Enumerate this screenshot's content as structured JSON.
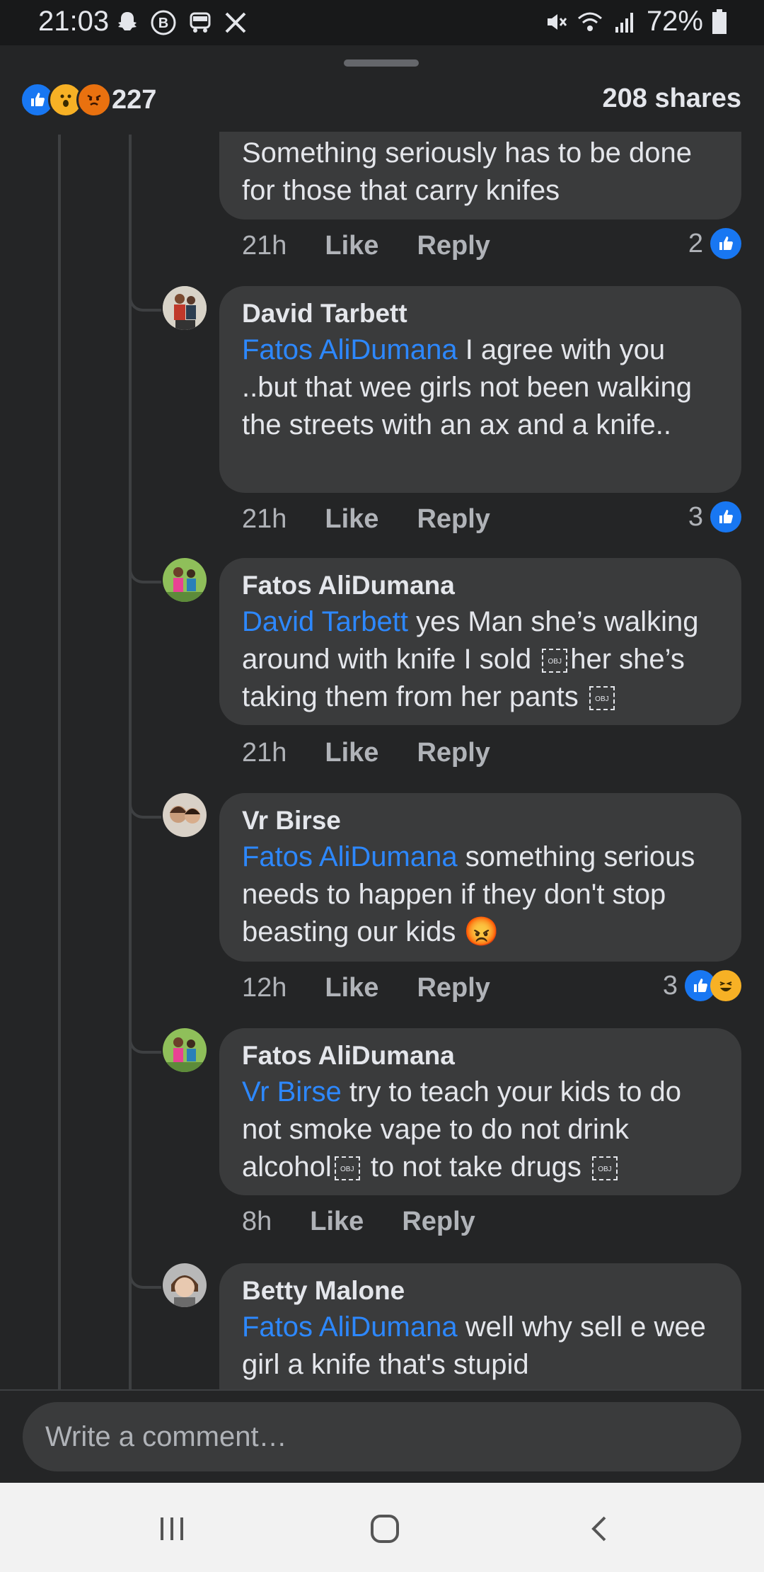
{
  "status_bar": {
    "time": "21:03",
    "battery": "72%",
    "left_icons": [
      "snapchat-icon",
      "bitcoin-icon",
      "car-icon",
      "x-icon"
    ],
    "right_icons": [
      "mute-icon",
      "wifi-icon",
      "signal-icon",
      "battery-icon"
    ]
  },
  "post_stats": {
    "reaction_count": "227",
    "shares": "208 shares",
    "reactions": [
      "like",
      "wow",
      "angry"
    ]
  },
  "comments": [
    {
      "author": "",
      "mention": "",
      "text": "Something seriously has to be done for those that carry knifes",
      "time": "21h",
      "like": "Like",
      "reply": "Reply",
      "likes": "2"
    },
    {
      "author": "David Tarbett",
      "mention": "Fatos AliDumana",
      "text": " I agree with you ..but that wee girls not been walking the streets with an ax and a knife..",
      "time": "21h",
      "like": "Like",
      "reply": "Reply",
      "likes": "3"
    },
    {
      "author": "Fatos AliDumana",
      "mention": "David Tarbett",
      "text_a": " yes Man she’s walking around with knife  I sold ",
      "text_b": "her she’s taking them from her pants ",
      "obj": "OBJ",
      "time": "21h",
      "like": "Like",
      "reply": "Reply",
      "likes": ""
    },
    {
      "author": "Vr Birse",
      "mention": "Fatos AliDumana",
      "text": " something serious needs to happen if they don't stop beasting our kids ",
      "emoji": "😡",
      "time": "12h",
      "like": "Like",
      "reply": "Reply",
      "likes": "3"
    },
    {
      "author": "Fatos AliDumana",
      "mention": "Vr Birse",
      "text_a": " try to teach your kids to do not smoke vape to do not drink alcohol",
      "text_b": " to not take drugs ",
      "obj": "OBJ",
      "time": "8h",
      "like": "Like",
      "reply": "Reply",
      "likes": ""
    },
    {
      "author": "Betty Malone",
      "mention": "Fatos AliDumana",
      "text": " well why sell e wee girl a knife that's stupid"
    }
  ],
  "composer": {
    "placeholder": "Write a comment…"
  },
  "colors": {
    "background": "#242526",
    "bubble": "#3a3b3c",
    "mention": "#2d88ff",
    "like_blue": "#1877f2"
  }
}
